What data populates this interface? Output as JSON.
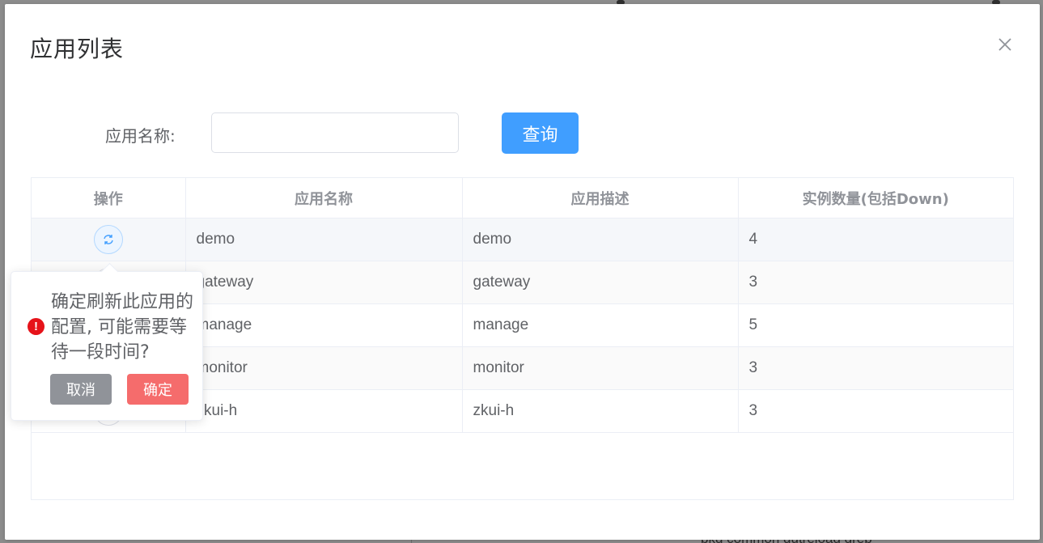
{
  "background": {
    "bottom_text": "bkg common dutreload grep"
  },
  "dialog": {
    "title": "应用列表",
    "close_icon": "close-icon"
  },
  "search": {
    "label": "应用名称:",
    "value": "",
    "placeholder": "",
    "button_label": "查询"
  },
  "table": {
    "columns": [
      "操作",
      "应用名称",
      "应用描述",
      "实例数量(包括Down)"
    ],
    "rows": [
      {
        "name": "demo",
        "desc": "demo",
        "count": "4"
      },
      {
        "name": "gateway",
        "desc": "gateway",
        "count": "3"
      },
      {
        "name": "manage",
        "desc": "manage",
        "count": "5"
      },
      {
        "name": "monitor",
        "desc": "monitor",
        "count": "3"
      },
      {
        "name": "zkui-h",
        "desc": "zkui-h",
        "count": "3"
      }
    ],
    "action_icon": "refresh-icon"
  },
  "popconfirm": {
    "message": "确定刷新此应用的配置, 可能需要等待一段时间?",
    "icon": "warning-icon",
    "cancel_label": "取消",
    "confirm_label": "确定"
  },
  "colors": {
    "primary": "#409eff",
    "danger": "#f56c6c",
    "info": "#909399",
    "warning_icon": "#e6131a"
  }
}
